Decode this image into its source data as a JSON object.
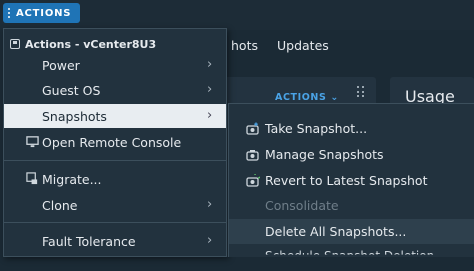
{
  "toolbar": {
    "actions_label": "ACTIONS"
  },
  "tabs": [
    {
      "label": "hots"
    },
    {
      "label": "Updates"
    }
  ],
  "panel": {
    "actions_label": "ACTIONS ⌄"
  },
  "usage": {
    "title": "Usage"
  },
  "menu": {
    "header": "Actions - vCenter8U3",
    "items": [
      {
        "label": "Power",
        "submenu": true
      },
      {
        "label": "Guest OS",
        "submenu": true
      },
      {
        "label": "Snapshots",
        "submenu": true,
        "active": true
      },
      {
        "label": "Open Remote Console",
        "submenu": false
      },
      {
        "label": "Migrate...",
        "submenu": false
      },
      {
        "label": "Clone",
        "submenu": true
      },
      {
        "label": "Fault Tolerance",
        "submenu": true
      }
    ]
  },
  "submenu": {
    "items": [
      {
        "label": "Take Snapshot...",
        "icon": "take-snapshot-icon"
      },
      {
        "label": "Manage Snapshots",
        "icon": "manage-snapshots-icon"
      },
      {
        "label": "Revert to Latest Snapshot",
        "icon": "revert-snapshot-icon"
      },
      {
        "label": "Consolidate",
        "disabled": true
      },
      {
        "label": "Delete All Snapshots...",
        "hover": true
      },
      {
        "label": "Schedule Snapshot Deletion",
        "partial": true
      }
    ]
  },
  "chev": "›",
  "colors": {
    "accent": "#1f74b6",
    "link": "#4aa3e6",
    "menu_bg": "#22323e",
    "active_bg": "#e8edf1"
  }
}
